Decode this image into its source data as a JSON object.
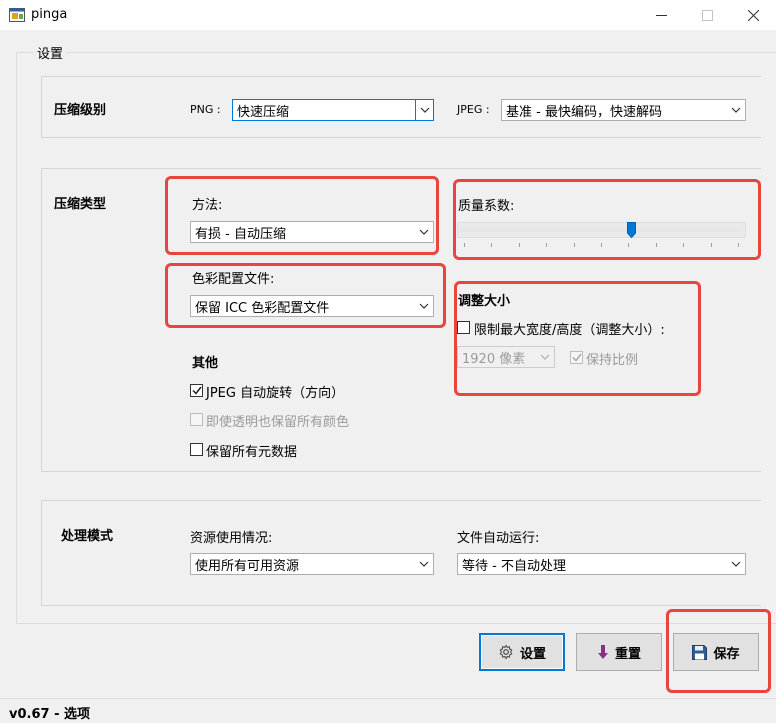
{
  "window": {
    "title": "pinga"
  },
  "settings_group": {
    "legend": "设置"
  },
  "compression_level": {
    "title": "压缩级别",
    "png_label": "PNG :",
    "png_value": "快速压缩",
    "jpeg_label": "JPEG :",
    "jpeg_value": "基准 - 最快编码，快速解码"
  },
  "compression_type": {
    "title": "压缩类型",
    "method_label": "方法:",
    "method_value": "有损 - 自动压缩",
    "color_profile_label": "色彩配置文件:",
    "color_profile_value": "保留 ICC 色彩配置文件",
    "quality_label": "质量系数:",
    "quality_slider": {
      "value_fraction": 0.61,
      "tick_count": 11
    },
    "resize": {
      "title": "调整大小",
      "limit_label": "限制最大宽度/高度（调整大小）:",
      "limit_checked": false,
      "size_value": "1920 像素",
      "keep_ratio_label": "保持比例",
      "keep_ratio_checked": true
    },
    "other": {
      "title": "其他",
      "jpeg_rotate_label": "JPEG 自动旋转（方向）",
      "jpeg_rotate_checked": true,
      "keep_colors_label": "即使透明也保留所有颜色",
      "keep_colors_checked": false,
      "keep_metadata_label": "保留所有元数据",
      "keep_metadata_checked": false
    }
  },
  "processing_mode": {
    "title": "处理模式",
    "resource_label": "资源使用情况:",
    "resource_value": "使用所有可用资源",
    "auto_run_label": "文件自动运行:",
    "auto_run_value": "等待 - 不自动处理"
  },
  "buttons": {
    "settings": "设置",
    "reset": "重置",
    "save": "保存"
  },
  "status": {
    "text": "v0.67 - 选项"
  },
  "colors": {
    "highlight": "#e8453c",
    "accent": "#0078d7",
    "reset_arrow": "#8a2e87",
    "save_disk": "#2e5d99"
  },
  "icons": [
    "app-icon",
    "minimize-icon",
    "maximize-icon",
    "close-icon",
    "chevron-down-icon",
    "checkmark-icon",
    "gear-icon",
    "arrow-down-icon",
    "floppy-disk-icon"
  ]
}
